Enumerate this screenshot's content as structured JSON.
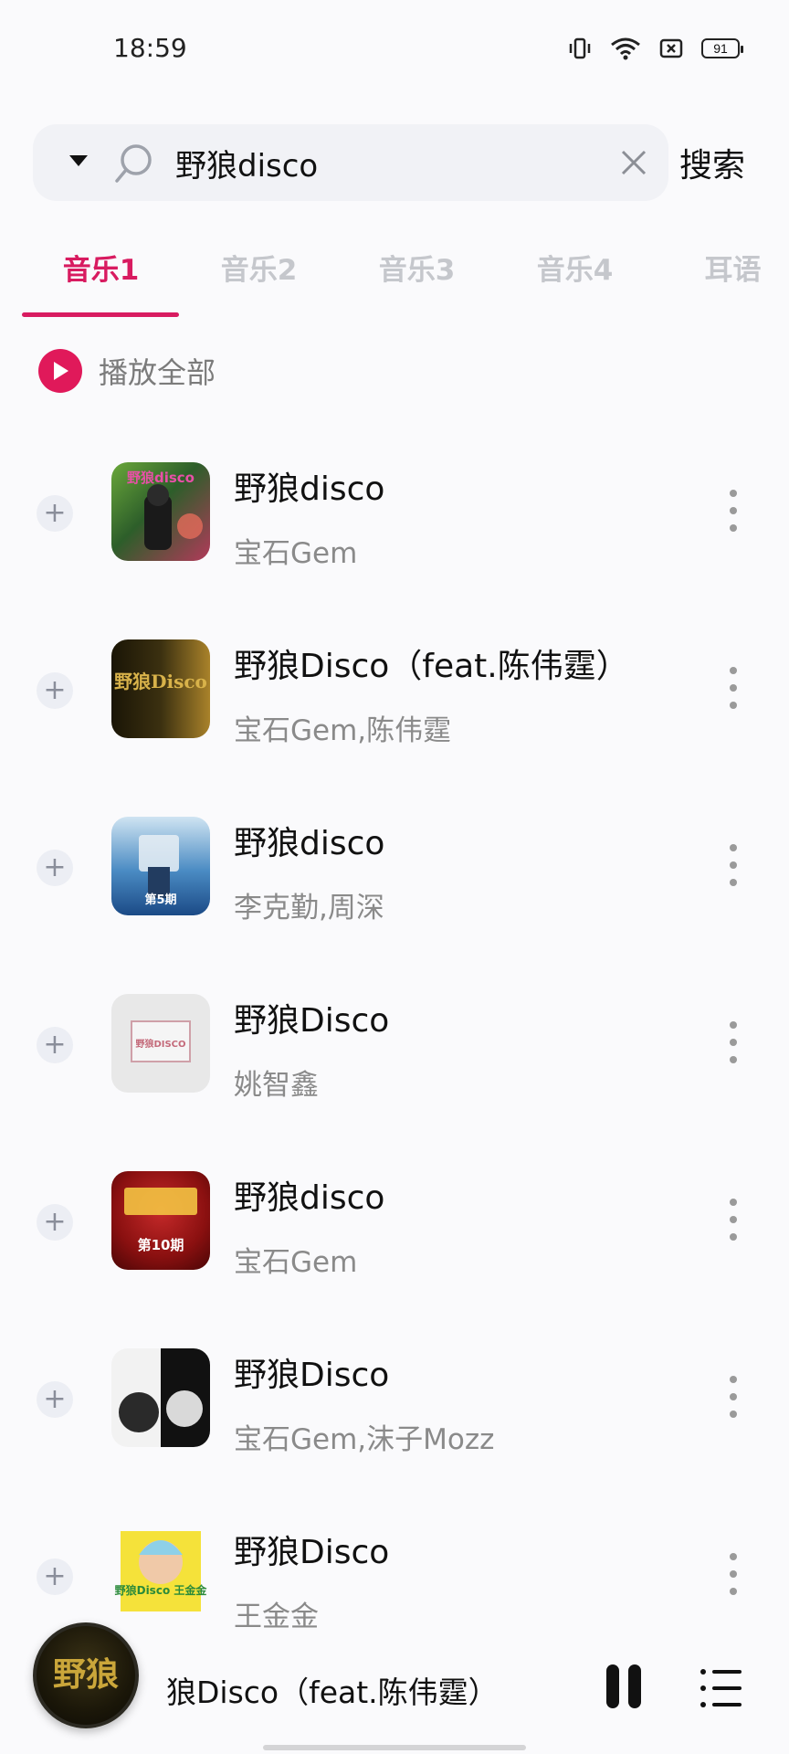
{
  "status_bar": {
    "time": "18:59",
    "battery": "91"
  },
  "search": {
    "value": "野狼disco",
    "button_label": "搜索"
  },
  "tabs": [
    {
      "label": "音乐1",
      "active": true
    },
    {
      "label": "音乐2",
      "active": false
    },
    {
      "label": "音乐3",
      "active": false
    },
    {
      "label": "音乐4",
      "active": false
    },
    {
      "label": "耳语",
      "active": false
    }
  ],
  "play_all": {
    "label": "播放全部"
  },
  "songs": [
    {
      "title": "野狼disco",
      "artist": "宝石Gem",
      "cover_text": "野狼disco"
    },
    {
      "title": "野狼Disco（feat.陈伟霆）",
      "artist": "宝石Gem,陈伟霆",
      "cover_text": "野狼Disco"
    },
    {
      "title": "野狼disco",
      "artist": "李克勤,周深",
      "cover_text": "第5期"
    },
    {
      "title": "野狼Disco",
      "artist": "姚智鑫",
      "cover_text": "野狼DISCO"
    },
    {
      "title": "野狼disco",
      "artist": "宝石Gem",
      "cover_text": "第10期"
    },
    {
      "title": "野狼Disco",
      "artist": "宝石Gem,沫子Mozz",
      "cover_text": ""
    },
    {
      "title": "野狼Disco",
      "artist": "王金金",
      "cover_text": "野狼Disco 王金金"
    }
  ],
  "mini_player": {
    "title": "狼Disco（feat.陈伟霆）",
    "cover_text": "野狼"
  },
  "colors": {
    "accent": "#d81b60",
    "inactive_tab": "#c5c7cc",
    "secondary_text": "#8a8a8a"
  }
}
